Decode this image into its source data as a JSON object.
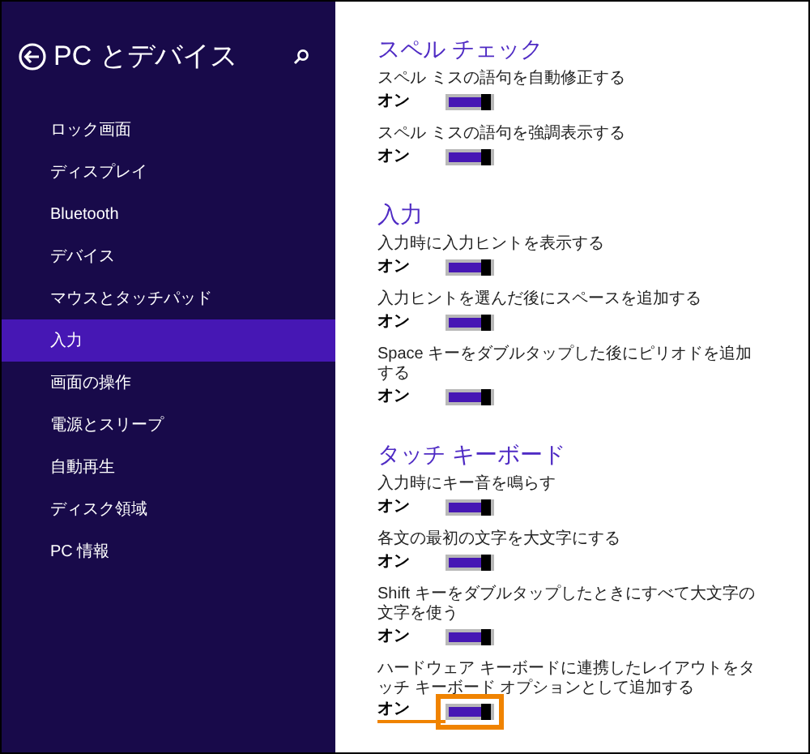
{
  "header": {
    "title": "PC とデバイス"
  },
  "sidebar": {
    "items": [
      {
        "label": "ロック画面",
        "selected": false
      },
      {
        "label": "ディスプレイ",
        "selected": false
      },
      {
        "label": "Bluetooth",
        "selected": false
      },
      {
        "label": "デバイス",
        "selected": false
      },
      {
        "label": "マウスとタッチパッド",
        "selected": false
      },
      {
        "label": "入力",
        "selected": true
      },
      {
        "label": "画面の操作",
        "selected": false
      },
      {
        "label": "電源とスリープ",
        "selected": false
      },
      {
        "label": "自動再生",
        "selected": false
      },
      {
        "label": "ディスク領域",
        "selected": false
      },
      {
        "label": "PC 情報",
        "selected": false
      }
    ]
  },
  "sections": [
    {
      "heading": "スペル チェック",
      "settings": [
        {
          "label": "スペル ミスの語句を自動修正する",
          "state_text": "オン",
          "on": true,
          "highlighted": false
        },
        {
          "label": "スペル ミスの語句を強調表示する",
          "state_text": "オン",
          "on": true,
          "highlighted": false
        }
      ]
    },
    {
      "heading": "入力",
      "settings": [
        {
          "label": "入力時に入力ヒントを表示する",
          "state_text": "オン",
          "on": true,
          "highlighted": false
        },
        {
          "label": "入力ヒントを選んだ後にスペースを追加する",
          "state_text": "オン",
          "on": true,
          "highlighted": false
        },
        {
          "label": "Space キーをダブルタップした後にピリオドを追加する",
          "state_text": "オン",
          "on": true,
          "highlighted": false
        }
      ]
    },
    {
      "heading": "タッチ キーボード",
      "settings": [
        {
          "label": "入力時にキー音を鳴らす",
          "state_text": "オン",
          "on": true,
          "highlighted": false
        },
        {
          "label": "各文の最初の文字を大文字にする",
          "state_text": "オン",
          "on": true,
          "highlighted": false
        },
        {
          "label": "Shift キーをダブルタップしたときにすべて大文字の文字を使う",
          "state_text": "オン",
          "on": true,
          "highlighted": false
        },
        {
          "label": "ハードウェア キーボードに連携したレイアウトをタッチ キーボード オプションとして追加する",
          "state_text": "オン",
          "on": true,
          "highlighted": true
        }
      ]
    }
  ]
}
